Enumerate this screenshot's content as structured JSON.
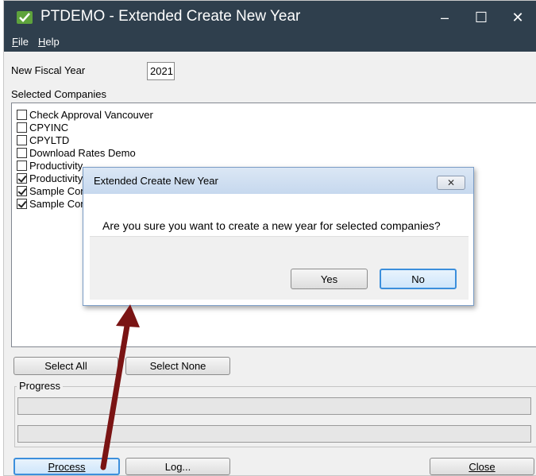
{
  "window": {
    "title": "PTDEMO - Extended Create New Year",
    "minimize_glyph": "–",
    "maximize_glyph": "☐",
    "close_glyph": "✕"
  },
  "menu": [
    "File",
    "Help"
  ],
  "form": {
    "fiscal_year_label": "New Fiscal Year",
    "fiscal_year_value": "2021",
    "companies_label": "Selected Companies"
  },
  "companies": [
    {
      "label": "Check Approval Vancouver",
      "checked": false
    },
    {
      "label": "CPYINC",
      "checked": false
    },
    {
      "label": "CPYLTD",
      "checked": false
    },
    {
      "label": "Download Rates Demo",
      "checked": false
    },
    {
      "label": "Productivity",
      "checked": false
    },
    {
      "label": "Productivity",
      "checked": true
    },
    {
      "label": "Sample Com",
      "checked": true
    },
    {
      "label": "Sample Com",
      "checked": true
    }
  ],
  "buttons": {
    "select_all": "Select All",
    "select_none": "Select None",
    "process": "Process",
    "log": "Log...",
    "close": "Close"
  },
  "progress_label": "Progress",
  "dialog": {
    "title": "Extended Create New Year",
    "close_glyph": "✕",
    "message": "Are you sure you want to create a new year for selected companies?",
    "yes": "Yes",
    "no": "No"
  },
  "colors": {
    "titlebar": "#2f3f4d",
    "arrow": "#7a1414",
    "primary_border": "#3c8fdc"
  }
}
